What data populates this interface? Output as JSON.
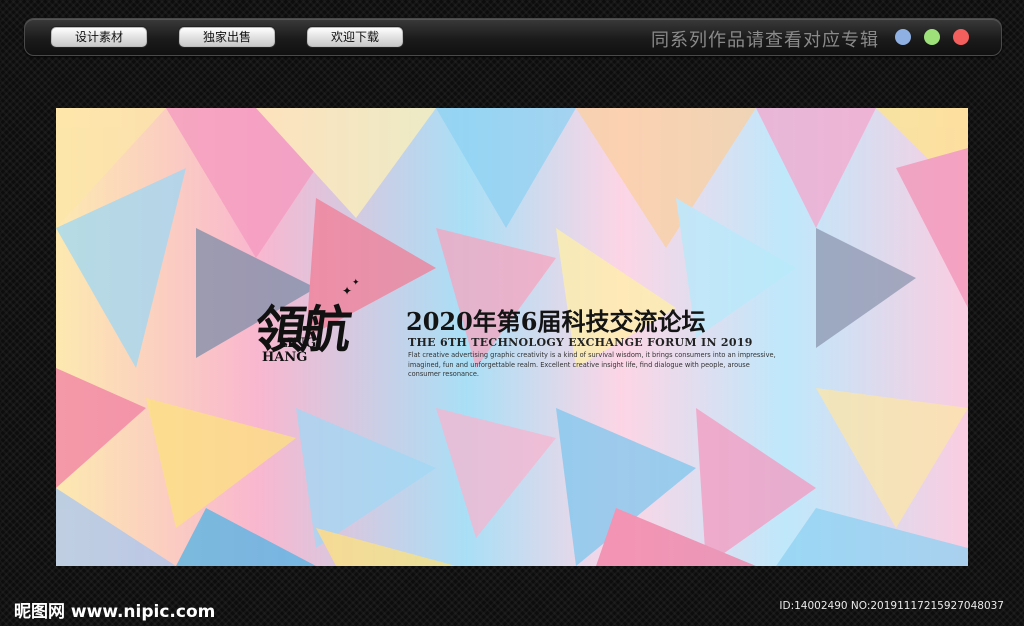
{
  "toolbar": {
    "buttons": [
      "设计素材",
      "独家出售",
      "欢迎下载"
    ],
    "tagline": "同系列作品请查看对应专辑",
    "dot_colors": [
      "#8fb0e3",
      "#9ee07a",
      "#f25f5c"
    ]
  },
  "banner": {
    "logo_cn": "領航",
    "logo_en_line1": "LING",
    "logo_en_line2": "HANG",
    "title": "2020年第6届科技交流论坛",
    "subtitle": "THE 6TH TECHNOLOGY EXCHANGE FORUM IN 2019",
    "description": "Flat creative advertising graphic creativity is a kind of survival wisdom, it brings consumers into an impressive, imagined, fun and unforgettable realm. Excellent creative insight life, find dialogue with people, arouse consumer resonance."
  },
  "watermark": {
    "site": "昵图网 www.nipic.com",
    "id_text": "ID:14002490 NO:20191117215927048037"
  }
}
